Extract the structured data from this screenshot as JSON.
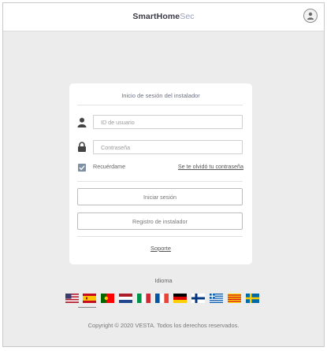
{
  "header": {
    "brand_part1": "Smart",
    "brand_part2": "Home",
    "brand_part3": "Sec"
  },
  "login": {
    "title": "Inicio de sesión del instalador",
    "user_id_placeholder": "ID de usuario",
    "password_placeholder": "Contraseña",
    "remember_label": "Recuérdame",
    "remember_checked": true,
    "forgot_link": "Se te olvidó tu contraseña",
    "login_button": "Iniciar sesión",
    "register_button": "Registro de instalador",
    "support_link": "Soporte"
  },
  "language": {
    "label": "Idioma",
    "selected": "es",
    "flags": [
      "us",
      "es",
      "pt",
      "nl",
      "it",
      "fr",
      "de",
      "fi",
      "gr",
      "ca",
      "se"
    ]
  },
  "footer": {
    "copyright": "Copyright © 2020 VESTA. Todos los derechos reservados."
  },
  "colors": {
    "background": "#ececec",
    "card": "#ffffff",
    "checkbox": "#7f8fa4",
    "brand_accent": "#9aa0b8"
  }
}
